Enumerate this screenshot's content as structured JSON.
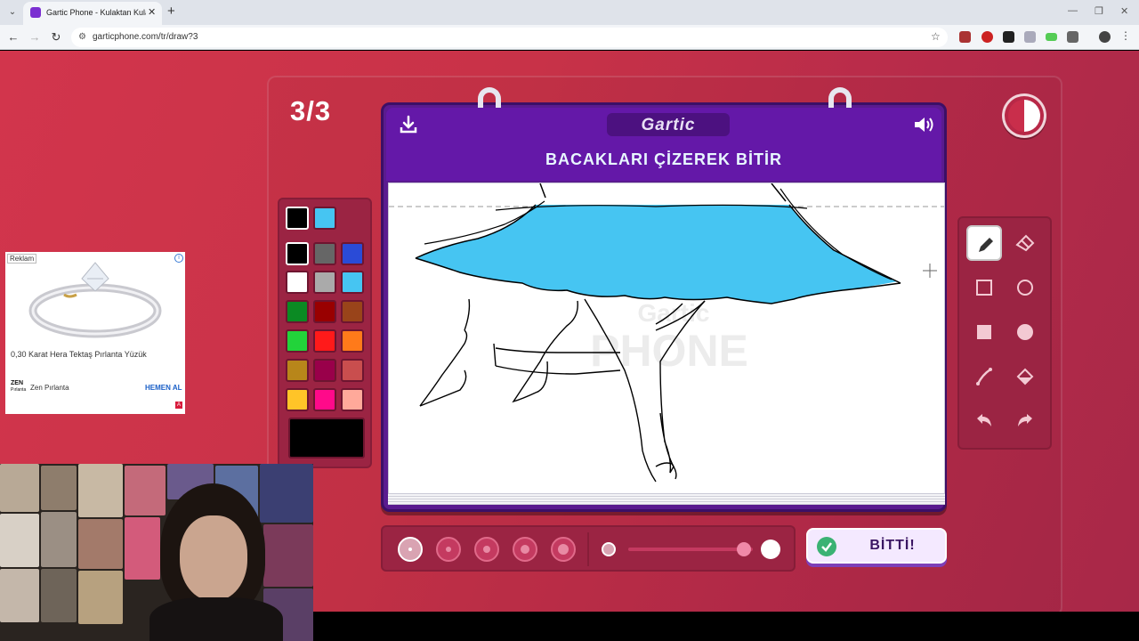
{
  "browser": {
    "tab_title": "Gartic Phone - Kulaktan Kulağa",
    "new_tab_symbol": "+",
    "close_symbol": "✕",
    "url": "garticphone.com/tr/draw?3"
  },
  "game": {
    "round": "3/3",
    "logo": "Gartic",
    "task": "BACAKLARI ÇİZEREK BİTİR",
    "watermark_top": "Gartic",
    "watermark_bottom": "PHONE",
    "done_label": "BİTTİ!",
    "palette": [
      "#000000",
      "#46c5f2",
      "#000000",
      "#666666",
      "#2a4bd7",
      "#ffffff",
      "#aaaaaa",
      "#46c5f2",
      "#0b8a23",
      "#990000",
      "#99441a",
      "#22d33a",
      "#ff1a1a",
      "#ff7a1a",
      "#b8861a",
      "#99004a",
      "#c94e4e",
      "#ffc428",
      "#ff0a8a",
      "#ffa99a"
    ],
    "selected_color": "#000000",
    "tools": [
      "pencil-icon",
      "eraser-icon",
      "rectangle-outline-icon",
      "ellipse-outline-icon",
      "rectangle-filled-icon",
      "ellipse-filled-icon",
      "line-icon",
      "fill-bucket-icon",
      "undo-icon",
      "redo-icon"
    ],
    "selected_brush_size": 1,
    "opacity": 0.9
  },
  "ad": {
    "badge": "Reklam",
    "title": "0,30 Karat Hera Tektaş Pırlanta Yüzük",
    "brand_logo_line1": "ZEN",
    "brand_logo_line2": "Pırlanta",
    "brand": "Zen Pırlanta",
    "cta": "HEMEN AL",
    "choice": "A"
  }
}
